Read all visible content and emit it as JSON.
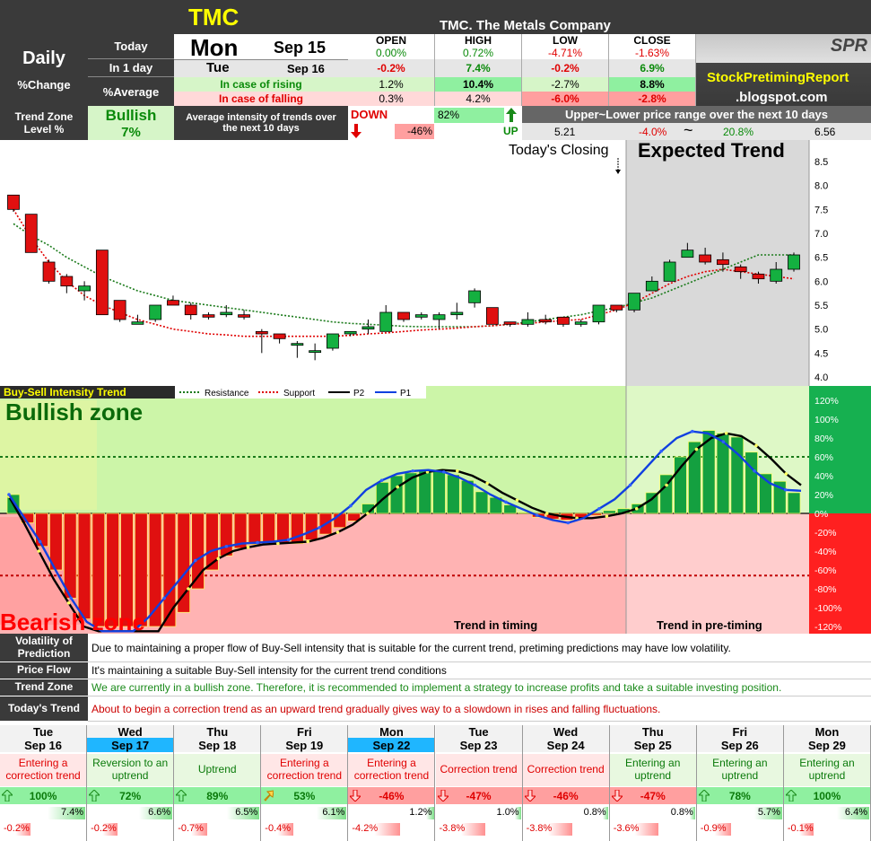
{
  "header": {
    "ticker": "TMC",
    "company": "TMC. The Metals Company"
  },
  "top": {
    "daily": "Daily",
    "pct_change": "%Change",
    "today_lbl": "Today",
    "in1day_lbl": "In 1 day",
    "avg_lbl": "%Average",
    "today_day": "Mon",
    "today_date": "Sep 15",
    "next_day": "Tue",
    "next_date": "Sep 16",
    "cols": [
      "OPEN",
      "HIGH",
      "LOW",
      "CLOSE"
    ],
    "today_vals": [
      "0.00%",
      "0.72%",
      "-4.71%",
      "-1.63%"
    ],
    "next_vals": [
      "-0.2%",
      "7.4%",
      "-0.2%",
      "6.9%"
    ],
    "rising_lbl": "In case of rising",
    "rising_vals": [
      "1.2%",
      "10.4%",
      "-2.7%",
      "8.8%"
    ],
    "falling_lbl": "In case of falling",
    "falling_vals": [
      "0.3%",
      "4.2%",
      "-6.0%",
      "-2.8%"
    ],
    "brand1": "StockPretimingReport",
    "brand2": ".blogspot.com",
    "logo": "SPR"
  },
  "trend_row": {
    "zone_lbl1": "Trend Zone",
    "zone_lbl2": "Level %",
    "zone_val": "Bullish",
    "zone_pct": "7%",
    "avg_text": "Average intensity of trends over the next 10 days",
    "down_lbl": "DOWN",
    "down_val": "-46%",
    "up_val": "82%",
    "up_lbl": "UP",
    "range_title": "Upper~Lower price range over the next 10 days",
    "range_low": "5.21",
    "range_low_pct": "-4.0%",
    "tilde": "~",
    "range_high_pct": "20.8%",
    "range_high": "6.56"
  },
  "chart_data": [
    {
      "type": "candlestick",
      "title": "",
      "annotations": [
        "Today's Closing",
        "Expected Trend"
      ],
      "ylim": [
        4.0,
        8.5
      ],
      "yticks": [
        "8.5",
        "8.0",
        "7.5",
        "7.0",
        "6.5",
        "6.0",
        "5.5",
        "5.0",
        "4.5",
        "4.0"
      ],
      "candles": [
        [
          7.8,
          7.5,
          7.8,
          7.45
        ],
        [
          7.4,
          6.6,
          7.4,
          6.6
        ],
        [
          6.4,
          6.0,
          6.45,
          5.95
        ],
        [
          6.1,
          5.9,
          6.15,
          5.75
        ],
        [
          5.8,
          5.9,
          6.0,
          5.6
        ],
        [
          6.65,
          5.3,
          6.65,
          5.3
        ],
        [
          5.6,
          5.2,
          5.6,
          5.15
        ],
        [
          5.1,
          5.15,
          5.3,
          5.1
        ],
        [
          5.2,
          5.5,
          5.5,
          5.15
        ],
        [
          5.6,
          5.5,
          5.7,
          5.5
        ],
        [
          5.5,
          5.3,
          5.55,
          5.2
        ],
        [
          5.3,
          5.25,
          5.35,
          5.2
        ],
        [
          5.3,
          5.35,
          5.5,
          5.25
        ],
        [
          5.3,
          5.25,
          5.4,
          5.2
        ],
        [
          4.95,
          4.9,
          5.0,
          4.5
        ],
        [
          4.9,
          4.8,
          4.9,
          4.7
        ],
        [
          4.7,
          4.7,
          4.75,
          4.4
        ],
        [
          4.55,
          4.55,
          4.7,
          4.35
        ],
        [
          4.6,
          4.9,
          4.9,
          4.55
        ],
        [
          4.9,
          4.95,
          4.95,
          4.85
        ],
        [
          5.0,
          5.05,
          5.2,
          4.9
        ],
        [
          4.95,
          5.35,
          5.5,
          4.95
        ],
        [
          5.35,
          5.2,
          5.35,
          5.15
        ],
        [
          5.25,
          5.3,
          5.35,
          5.2
        ],
        [
          5.2,
          5.3,
          5.35,
          5.0
        ],
        [
          5.3,
          5.35,
          5.55,
          5.2
        ],
        [
          5.55,
          5.8,
          5.85,
          5.45
        ],
        [
          5.45,
          5.1,
          5.45,
          5.1
        ],
        [
          5.15,
          5.1,
          5.15,
          5.05
        ],
        [
          5.1,
          5.2,
          5.35,
          5.05
        ],
        [
          5.2,
          5.15,
          5.3,
          5.1
        ],
        [
          5.25,
          5.1,
          5.25,
          5.05
        ],
        [
          5.1,
          5.15,
          5.2,
          5.05
        ],
        [
          5.15,
          5.5,
          5.5,
          5.1
        ],
        [
          5.5,
          5.4,
          5.5,
          5.35
        ],
        [
          5.4,
          5.75,
          5.75,
          5.35
        ],
        [
          5.8,
          6.0,
          6.1,
          5.8
        ],
        [
          6.0,
          6.4,
          6.45,
          6.0
        ],
        [
          6.5,
          6.65,
          6.8,
          6.5
        ],
        [
          6.55,
          6.4,
          6.7,
          6.35
        ],
        [
          6.45,
          6.35,
          6.6,
          6.2
        ],
        [
          6.3,
          6.2,
          6.35,
          6.05
        ],
        [
          6.15,
          6.05,
          6.2,
          5.95
        ],
        [
          6.0,
          6.25,
          6.4,
          5.95
        ],
        [
          6.25,
          6.55,
          6.6,
          6.2
        ]
      ],
      "resistance": [
        7.2,
        6.95,
        6.75,
        6.5,
        6.3,
        6.1,
        5.95,
        5.8,
        5.7,
        5.6,
        5.55,
        5.5,
        5.45,
        5.4,
        5.35,
        5.3,
        5.25,
        5.2,
        5.15,
        5.12,
        5.1,
        5.08,
        5.06,
        5.05,
        5.05,
        5.05,
        5.05,
        5.07,
        5.1,
        5.15,
        5.2,
        5.25,
        5.3,
        5.38,
        5.45,
        5.55,
        5.65,
        5.8,
        5.95,
        6.1,
        6.25,
        6.4,
        6.55,
        6.55,
        6.55
      ],
      "support": [
        7.5,
        6.9,
        6.4,
        6.0,
        5.7,
        5.5,
        5.35,
        5.2,
        5.1,
        5.0,
        4.95,
        4.9,
        4.88,
        4.85,
        4.85,
        4.85,
        4.85,
        4.85,
        4.85,
        4.87,
        4.9,
        4.92,
        4.95,
        4.98,
        5.0,
        5.02,
        5.05,
        5.07,
        5.1,
        5.12,
        5.15,
        5.18,
        5.2,
        5.3,
        5.4,
        5.55,
        5.75,
        5.95,
        6.1,
        6.2,
        6.25,
        6.2,
        6.15,
        6.1,
        6.05
      ]
    },
    {
      "type": "bar",
      "title": "Buy-Sell Intensity Trend",
      "legend": [
        "Resistance",
        "Support",
        "P2",
        "P1"
      ],
      "zones": [
        "Bullish zone",
        "Bearish zone"
      ],
      "notes": [
        "Trend in timing",
        "Trend in pre-timing"
      ],
      "ylim": [
        -120,
        120
      ],
      "yticks": [
        "120%",
        "100%",
        "80%",
        "60%",
        "40%",
        "20%",
        "0%",
        "-20%",
        "-40%",
        "-60%",
        "-80%",
        "-100%",
        "-120%"
      ],
      "values": [
        20,
        -10,
        -35,
        -60,
        -90,
        -112,
        -120,
        -120,
        -120,
        -120,
        -120,
        -120,
        -105,
        -80,
        -60,
        -45,
        -37,
        -33,
        -32,
        -32,
        -32,
        -28,
        -22,
        -15,
        -8,
        10,
        33,
        40,
        43,
        45,
        46,
        41,
        35,
        23,
        17,
        9,
        1,
        -4,
        -6,
        -7,
        -5,
        -2,
        3,
        5,
        10,
        22,
        41,
        60,
        76,
        88,
        85,
        81,
        65,
        42,
        34,
        22
      ],
      "p2": [
        18,
        -10,
        -40,
        -70,
        -95,
        -120,
        -140,
        -160,
        -170,
        -150,
        -130,
        -100,
        -80,
        -60,
        -48,
        -40,
        -36,
        -33,
        -32,
        -31,
        -30,
        -26,
        -20,
        -12,
        0,
        15,
        28,
        38,
        44,
        46,
        45,
        40,
        32,
        22,
        14,
        6,
        0,
        -3,
        -5,
        -5,
        -3,
        0,
        5,
        15,
        30,
        50,
        68,
        80,
        85,
        82,
        72,
        58,
        42,
        30
      ],
      "p1": [
        20,
        -5,
        -30,
        -60,
        -90,
        -115,
        -130,
        -140,
        -130,
        -110,
        -90,
        -70,
        -50,
        -40,
        -35,
        -32,
        -31,
        -30,
        -28,
        -22,
        -15,
        -5,
        8,
        25,
        35,
        42,
        45,
        46,
        44,
        38,
        30,
        20,
        12,
        5,
        -2,
        -7,
        -10,
        -5,
        5,
        15,
        30,
        48,
        66,
        80,
        87,
        85,
        76,
        62,
        45,
        32,
        25,
        24
      ],
      "resistance_level": 60,
      "support_level": -66
    }
  ],
  "info": [
    {
      "label": "Volatility of Prediction",
      "text": "Due to maintaining a proper flow of Buy-Sell intensity that is suitable for the current trend, pretiming predictions may have low volatility.",
      "color": "#000000"
    },
    {
      "label": "Price Flow",
      "text": "It's maintaining a suitable Buy-Sell intensity for the current trend conditions",
      "color": "#000000"
    },
    {
      "label": "Trend Zone",
      "text": "We are currently in a bullish zone. Therefore, it is recommended to implement a strategy to increase profits and take a suitable investing position.",
      "color": "#1a8a1a"
    },
    {
      "label": "Today's Trend",
      "text": "About to begin a correction trend as an upward trend gradually gives way to a slowdown in rises and falling fluctuations.",
      "color": "#cc0000"
    }
  ],
  "forecast": [
    {
      "day": "Tue",
      "date": "Sep 16",
      "hl": false,
      "trend": "Entering a correction trend",
      "tcol": "red",
      "dir": "up",
      "pct": "100%",
      "up": "7.4%",
      "upw": 0.7,
      "dn": "-0.2%",
      "dnw": 0.05
    },
    {
      "day": "Wed",
      "date": "Sep 17",
      "hl": true,
      "trend": "Reversion to an uptrend",
      "tcol": "green",
      "dir": "up",
      "pct": "72%",
      "up": "6.6%",
      "upw": 0.62,
      "dn": "-0.2%",
      "dnw": 0.05
    },
    {
      "day": "Thu",
      "date": "Sep 18",
      "hl": false,
      "trend": "Uptrend",
      "tcol": "green",
      "dir": "up",
      "pct": "89%",
      "up": "6.5%",
      "upw": 0.6,
      "dn": "-0.7%",
      "dnw": 0.1
    },
    {
      "day": "Fri",
      "date": "Sep 19",
      "hl": false,
      "trend": "Entering a correction trend",
      "tcol": "red",
      "dir": "upright",
      "pct": "53%",
      "up": "6.1%",
      "upw": 0.55,
      "dn": "-0.4%",
      "dnw": 0.08
    },
    {
      "day": "Mon",
      "date": "Sep 22",
      "hl": true,
      "trend": "Entering a correction trend",
      "tcol": "red",
      "dir": "down",
      "pct": "-46%",
      "up": "1.2%",
      "upw": 0.15,
      "dn": "-4.2%",
      "dnw": 0.45
    },
    {
      "day": "Tue",
      "date": "Sep 23",
      "hl": false,
      "trend": "Correction trend",
      "tcol": "red",
      "dir": "down",
      "pct": "-47%",
      "up": "1.0%",
      "upw": 0.12,
      "dn": "-3.8%",
      "dnw": 0.4
    },
    {
      "day": "Wed",
      "date": "Sep 24",
      "hl": false,
      "trend": "Correction trend",
      "tcol": "red",
      "dir": "down",
      "pct": "-46%",
      "up": "0.8%",
      "upw": 0.1,
      "dn": "-3.8%",
      "dnw": 0.4
    },
    {
      "day": "Thu",
      "date": "Sep 25",
      "hl": false,
      "trend": "Entering an uptrend",
      "tcol": "green",
      "dir": "down",
      "pct": "-47%",
      "up": "0.8%",
      "upw": 0.1,
      "dn": "-3.6%",
      "dnw": 0.38
    },
    {
      "day": "Fri",
      "date": "Sep 26",
      "hl": false,
      "trend": "Entering an uptrend",
      "tcol": "green",
      "dir": "up",
      "pct": "78%",
      "up": "5.7%",
      "upw": 0.52,
      "dn": "-0.9%",
      "dnw": 0.12
    },
    {
      "day": "Mon",
      "date": "Sep 29",
      "hl": false,
      "trend": "Entering an uptrend",
      "tcol": "green",
      "dir": "up",
      "pct": "100%",
      "up": "6.4%",
      "upw": 0.6,
      "dn": "-0.1%",
      "dnw": 0.04
    }
  ]
}
